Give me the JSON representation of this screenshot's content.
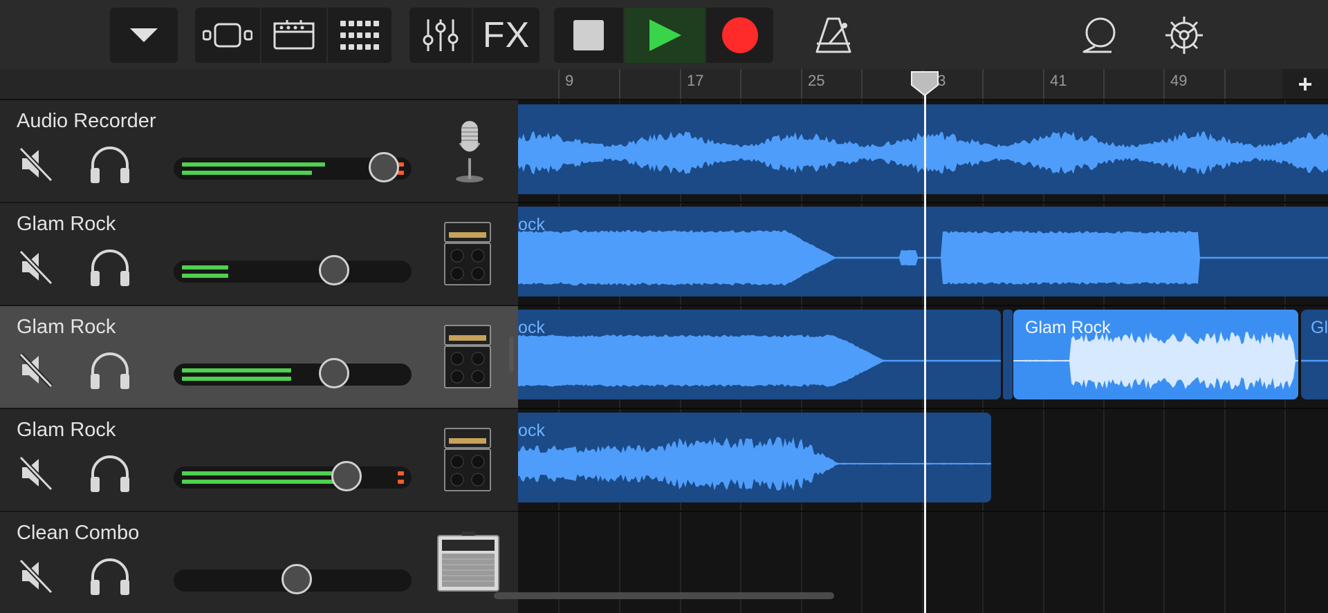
{
  "toolbar": {
    "groups": [
      {
        "id": "view-menu",
        "items": [
          {
            "icon": "chevron-down-icon"
          }
        ]
      },
      {
        "id": "views",
        "items": [
          {
            "icon": "track-view-icon"
          },
          {
            "icon": "instrument-view-icon"
          },
          {
            "icon": "grid-view-icon"
          }
        ]
      },
      {
        "id": "mix",
        "items": [
          {
            "icon": "mixer-sliders-icon"
          },
          {
            "icon": "fx-icon",
            "label": "FX"
          }
        ]
      },
      {
        "id": "transport",
        "items": [
          {
            "icon": "stop-icon"
          },
          {
            "icon": "play-icon"
          },
          {
            "icon": "record-icon"
          }
        ]
      }
    ],
    "fx_label": "FX",
    "colors": {
      "play_bg": "#1f3d1f",
      "play_icon": "#3ad44a",
      "record": "#ff2b2b"
    }
  },
  "ruler": {
    "bars": [
      "9",
      "17",
      "25",
      "33",
      "41",
      "49"
    ],
    "add_button": "+"
  },
  "tracks": [
    {
      "name": "Audio Recorder",
      "instrument": "microphone-icon",
      "meter_top": 0.68,
      "meter_bottom": 0.62,
      "clip": true,
      "volume": 0.94,
      "selected": false
    },
    {
      "name": "Glam Rock",
      "instrument": "amp-stack-icon",
      "meter_top": 0.22,
      "meter_bottom": 0.22,
      "clip": false,
      "volume": 0.7,
      "selected": false
    },
    {
      "name": "Glam Rock",
      "instrument": "amp-stack-icon",
      "meter_top": 0.52,
      "meter_bottom": 0.52,
      "clip": false,
      "volume": 0.7,
      "selected": true
    },
    {
      "name": "Glam Rock",
      "instrument": "amp-stack-icon",
      "meter_top": 0.76,
      "meter_bottom": 0.76,
      "clip": true,
      "volume": 0.76,
      "selected": false
    },
    {
      "name": "Clean Combo",
      "instrument": "combo-amp-icon",
      "meter_top": 0,
      "meter_bottom": 0,
      "clip": false,
      "volume": 0.52,
      "selected": false
    }
  ],
  "regions": {
    "lane2": "ock",
    "lane3_left": "ock",
    "lane3_selected": "Glam Rock",
    "lane3_right": "Gl",
    "lane4": "ock"
  },
  "playhead_bar": 33,
  "colors": {
    "region": "#1b4a86",
    "region_selected": "#3b8ff2",
    "waveform": "#4f9dfa",
    "meter": "#4fd04f",
    "clip": "#ff5a2a"
  }
}
